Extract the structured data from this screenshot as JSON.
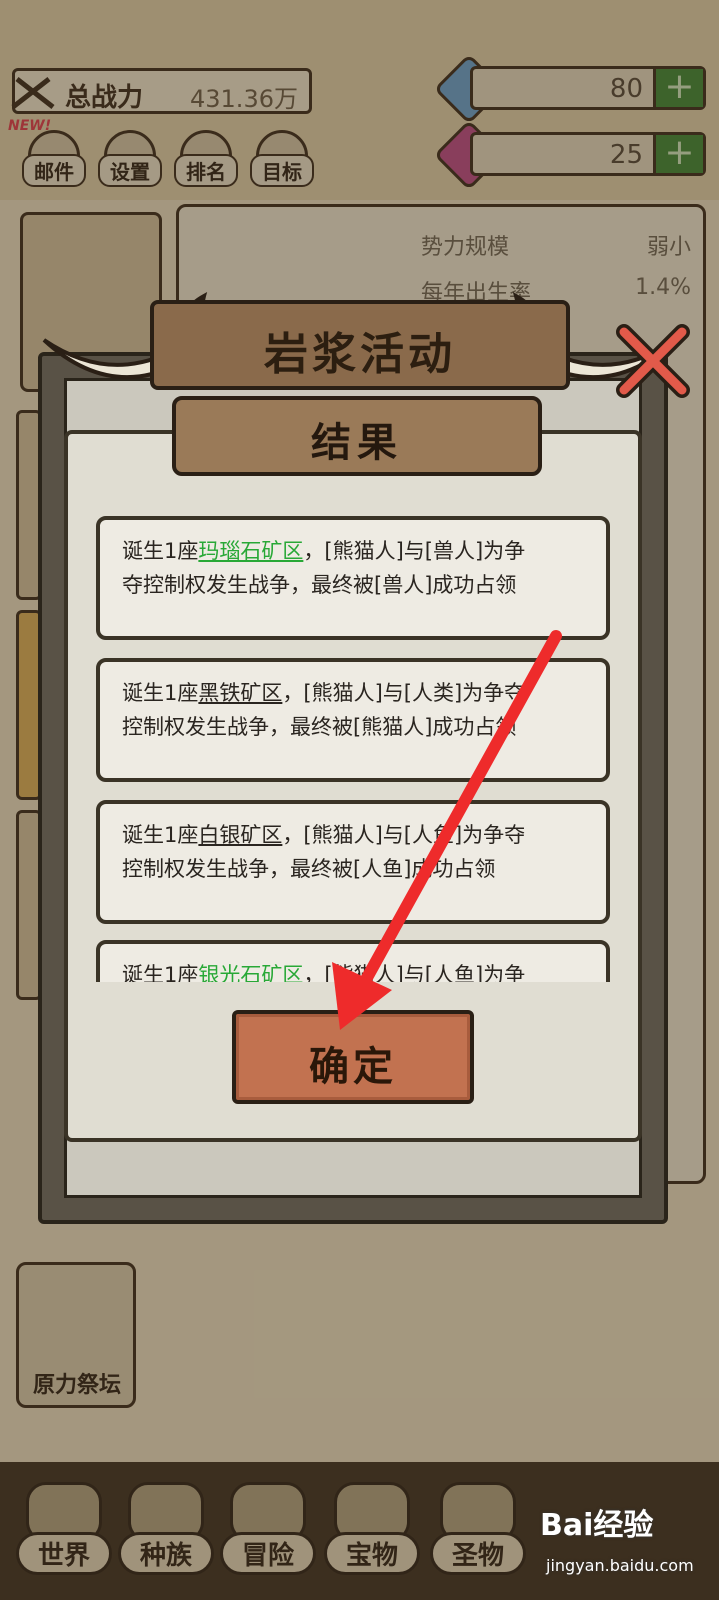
{
  "hud": {
    "power_label": "总战力",
    "power_value": "431.36万",
    "resources": [
      {
        "icon": "snowflake-gem-icon",
        "value": "80",
        "plus": "+",
        "color": "#6aa6d6"
      },
      {
        "icon": "purple-gem-icon",
        "value": "25",
        "plus": "+",
        "color": "#c24a8a"
      }
    ],
    "new_badge": "NEW!",
    "top_buttons": [
      "邮件",
      "设置",
      "排名",
      "目标"
    ]
  },
  "stats": [
    {
      "label": "势力规模",
      "value": "弱小"
    },
    {
      "label": "每年出生率",
      "value": "1.4%"
    }
  ],
  "altar_label": "原力祭坛",
  "bottom_nav": [
    "世界",
    "种族",
    "冒险",
    "宝物",
    "圣物"
  ],
  "dialog": {
    "title": "岩浆活动",
    "subtitle": "结果",
    "results": [
      {
        "prefix": "诞生1座",
        "location": "玛瑙石矿区",
        "suffix": "，[熊猫人]与[兽人]为争",
        "line2": "夺控制权发生战争，最终被[兽人]成功占领",
        "location_color": "#28a836"
      },
      {
        "prefix": "诞生1座",
        "location": "黑铁矿区",
        "suffix": "，[熊猫人]与[人类]为争夺",
        "line2": "控制权发生战争，最终被[熊猫人]成功占领",
        "location_color": "#2a2520"
      },
      {
        "prefix": "诞生1座",
        "location": "白银矿区",
        "suffix": "，[熊猫人]与[人鱼]为争夺",
        "line2": "控制权发生战争，最终被[人鱼]成功占领",
        "location_color": "#2a2520"
      },
      {
        "prefix": "诞生1座",
        "location": "银光石矿区",
        "suffix": "，[熊猫人]与[人鱼]为争",
        "line2": "",
        "location_color": "#28a836"
      }
    ],
    "confirm_label": "确定"
  },
  "annotation": {
    "arrow_color": "#ee2b2b"
  },
  "watermark": {
    "logo": "Bai经验",
    "site": "jingyan.baidu.com"
  }
}
